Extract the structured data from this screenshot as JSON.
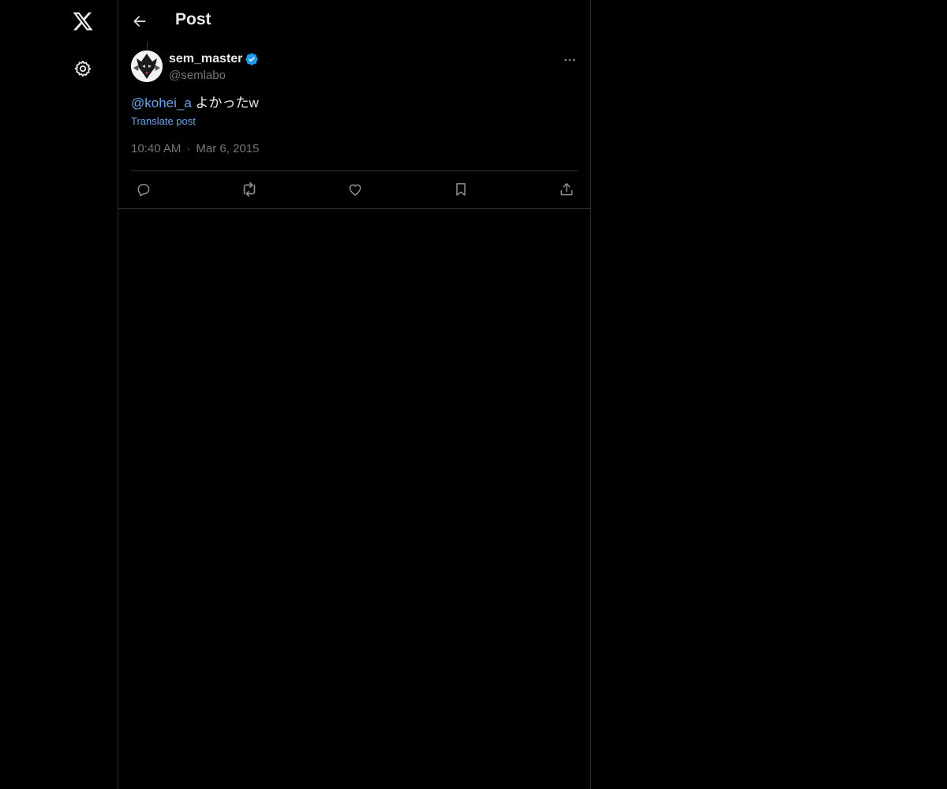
{
  "nav": {
    "logo_icon": "x-logo-icon",
    "settings_icon": "gear-icon"
  },
  "header": {
    "back_icon": "arrow-left-icon",
    "title": "Post"
  },
  "post": {
    "author": {
      "display_name": "sem_master",
      "handle": "@semlabo",
      "verified": true,
      "verified_color": "#1d9bf0"
    },
    "mention": "@kohei_a",
    "text": " よかったw",
    "translate_label": "Translate post",
    "time": "10:40 AM",
    "separator": "·",
    "date": "Mar 6, 2015"
  },
  "actions": [
    {
      "name": "reply",
      "icon": "reply-icon"
    },
    {
      "name": "repost",
      "icon": "repost-icon"
    },
    {
      "name": "like",
      "icon": "heart-icon"
    },
    {
      "name": "bookmark",
      "icon": "bookmark-icon"
    },
    {
      "name": "share",
      "icon": "share-icon"
    }
  ],
  "colors": {
    "background": "#000000",
    "link": "#6ba3e8",
    "muted": "#71767b",
    "border": "#2f3336"
  }
}
